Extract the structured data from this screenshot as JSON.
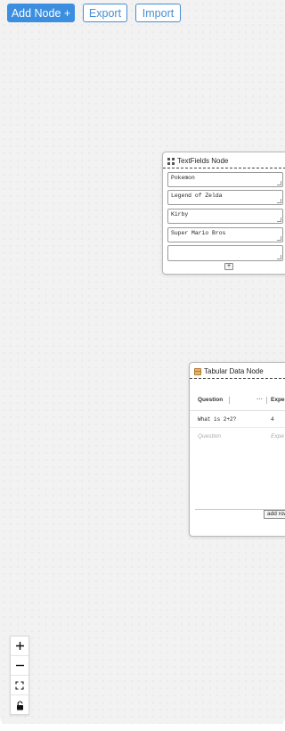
{
  "toolbar": {
    "add_node_label": "Add Node +",
    "export_label": "Export",
    "import_label": "Import"
  },
  "textfields_node": {
    "title": "TextFields Node",
    "icon": "grid-icon",
    "fields": [
      "Pokemon",
      "Legend of Zelda",
      "Kirby",
      "Super Mario Bros",
      ""
    ],
    "add_label": "+"
  },
  "tabular_node": {
    "title": "Tabular Data Node",
    "icon": "table-icon",
    "columns": [
      "Question",
      "Expe"
    ],
    "menu_label": "···",
    "rows": [
      [
        "What is 2+2?",
        "4"
      ]
    ],
    "placeholders": [
      "Question",
      "Expe"
    ],
    "add_row_label": "add row"
  },
  "controls": {
    "zoom_in": "zoom-in-icon",
    "zoom_out": "zoom-out-icon",
    "fit_view": "fit-view-icon",
    "lock": "lock-icon"
  },
  "colors": {
    "accent": "#3b8ee0",
    "outline": "#4a8dd0",
    "canvas_bg": "#f2f2f2"
  }
}
